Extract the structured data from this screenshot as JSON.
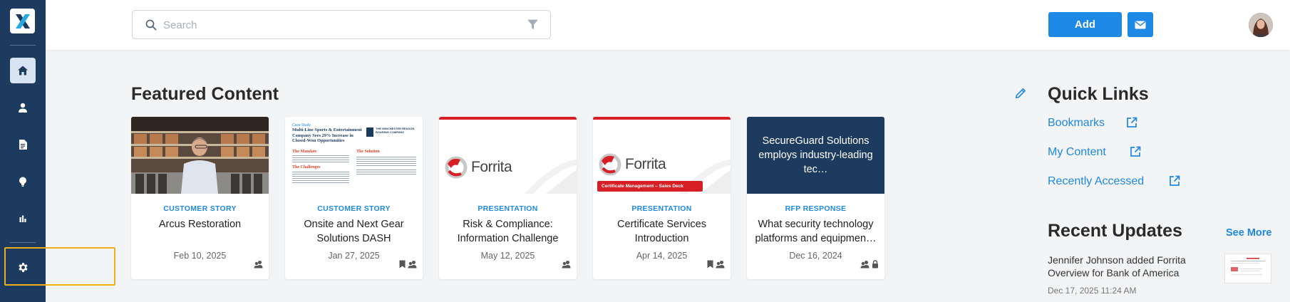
{
  "search": {
    "placeholder": "Search"
  },
  "toolbar": {
    "add_label": "Add"
  },
  "featured": {
    "title": "Featured Content",
    "cards": [
      {
        "category": "CUSTOMER STORY",
        "title": "Arcus Restoration",
        "date": "Feb 10, 2025"
      },
      {
        "category": "CUSTOMER STORY",
        "title": "Onsite and Next Gear Solutions DASH",
        "date": "Jan 27, 2025",
        "thumb": {
          "header": "Case Study",
          "headline": "Multi-Line Sports & Entertainment Company Sees 29% Increase in Closed-Won Opportunities",
          "company": "THE WINCHESTER REASON ROARING COMPANY",
          "challenges": "The Challenges",
          "mandate": "The Mandate",
          "solution": "The Solution"
        }
      },
      {
        "category": "PRESENTATION",
        "title": "Risk & Compliance: Information Challenge",
        "date": "May 12, 2025",
        "thumb": {
          "brand": "Forrita"
        }
      },
      {
        "category": "PRESENTATION",
        "title": "Certificate Services Introduction",
        "date": "Apr 14, 2025",
        "thumb": {
          "brand": "Forrita",
          "banner": "Certificate Management – Sales Deck"
        }
      },
      {
        "category": "RFP RESPONSE",
        "title": "What security technology platforms and equipmen…",
        "date": "Dec 16, 2024",
        "thumb": {
          "text": "SecureGuard Solutions employs industry-leading tec…"
        }
      }
    ]
  },
  "quick_links": {
    "title": "Quick Links",
    "items": [
      {
        "label": "Bookmarks"
      },
      {
        "label": "My Content"
      },
      {
        "label": "Recently Accessed"
      }
    ]
  },
  "recent_updates": {
    "title": "Recent Updates",
    "see_more": "See More",
    "items": [
      {
        "text": "Jennifer Johnson added Forrita Overview for Bank of America",
        "date": "Dec 17, 2025 11:24 AM"
      }
    ]
  },
  "colors": {
    "sidebar": "#1c3b5e",
    "accent": "#1e88e5",
    "highlight": "#f0ad1c",
    "forrita_red": "#d71f26",
    "rfp_navy": "#1c3b5e"
  }
}
